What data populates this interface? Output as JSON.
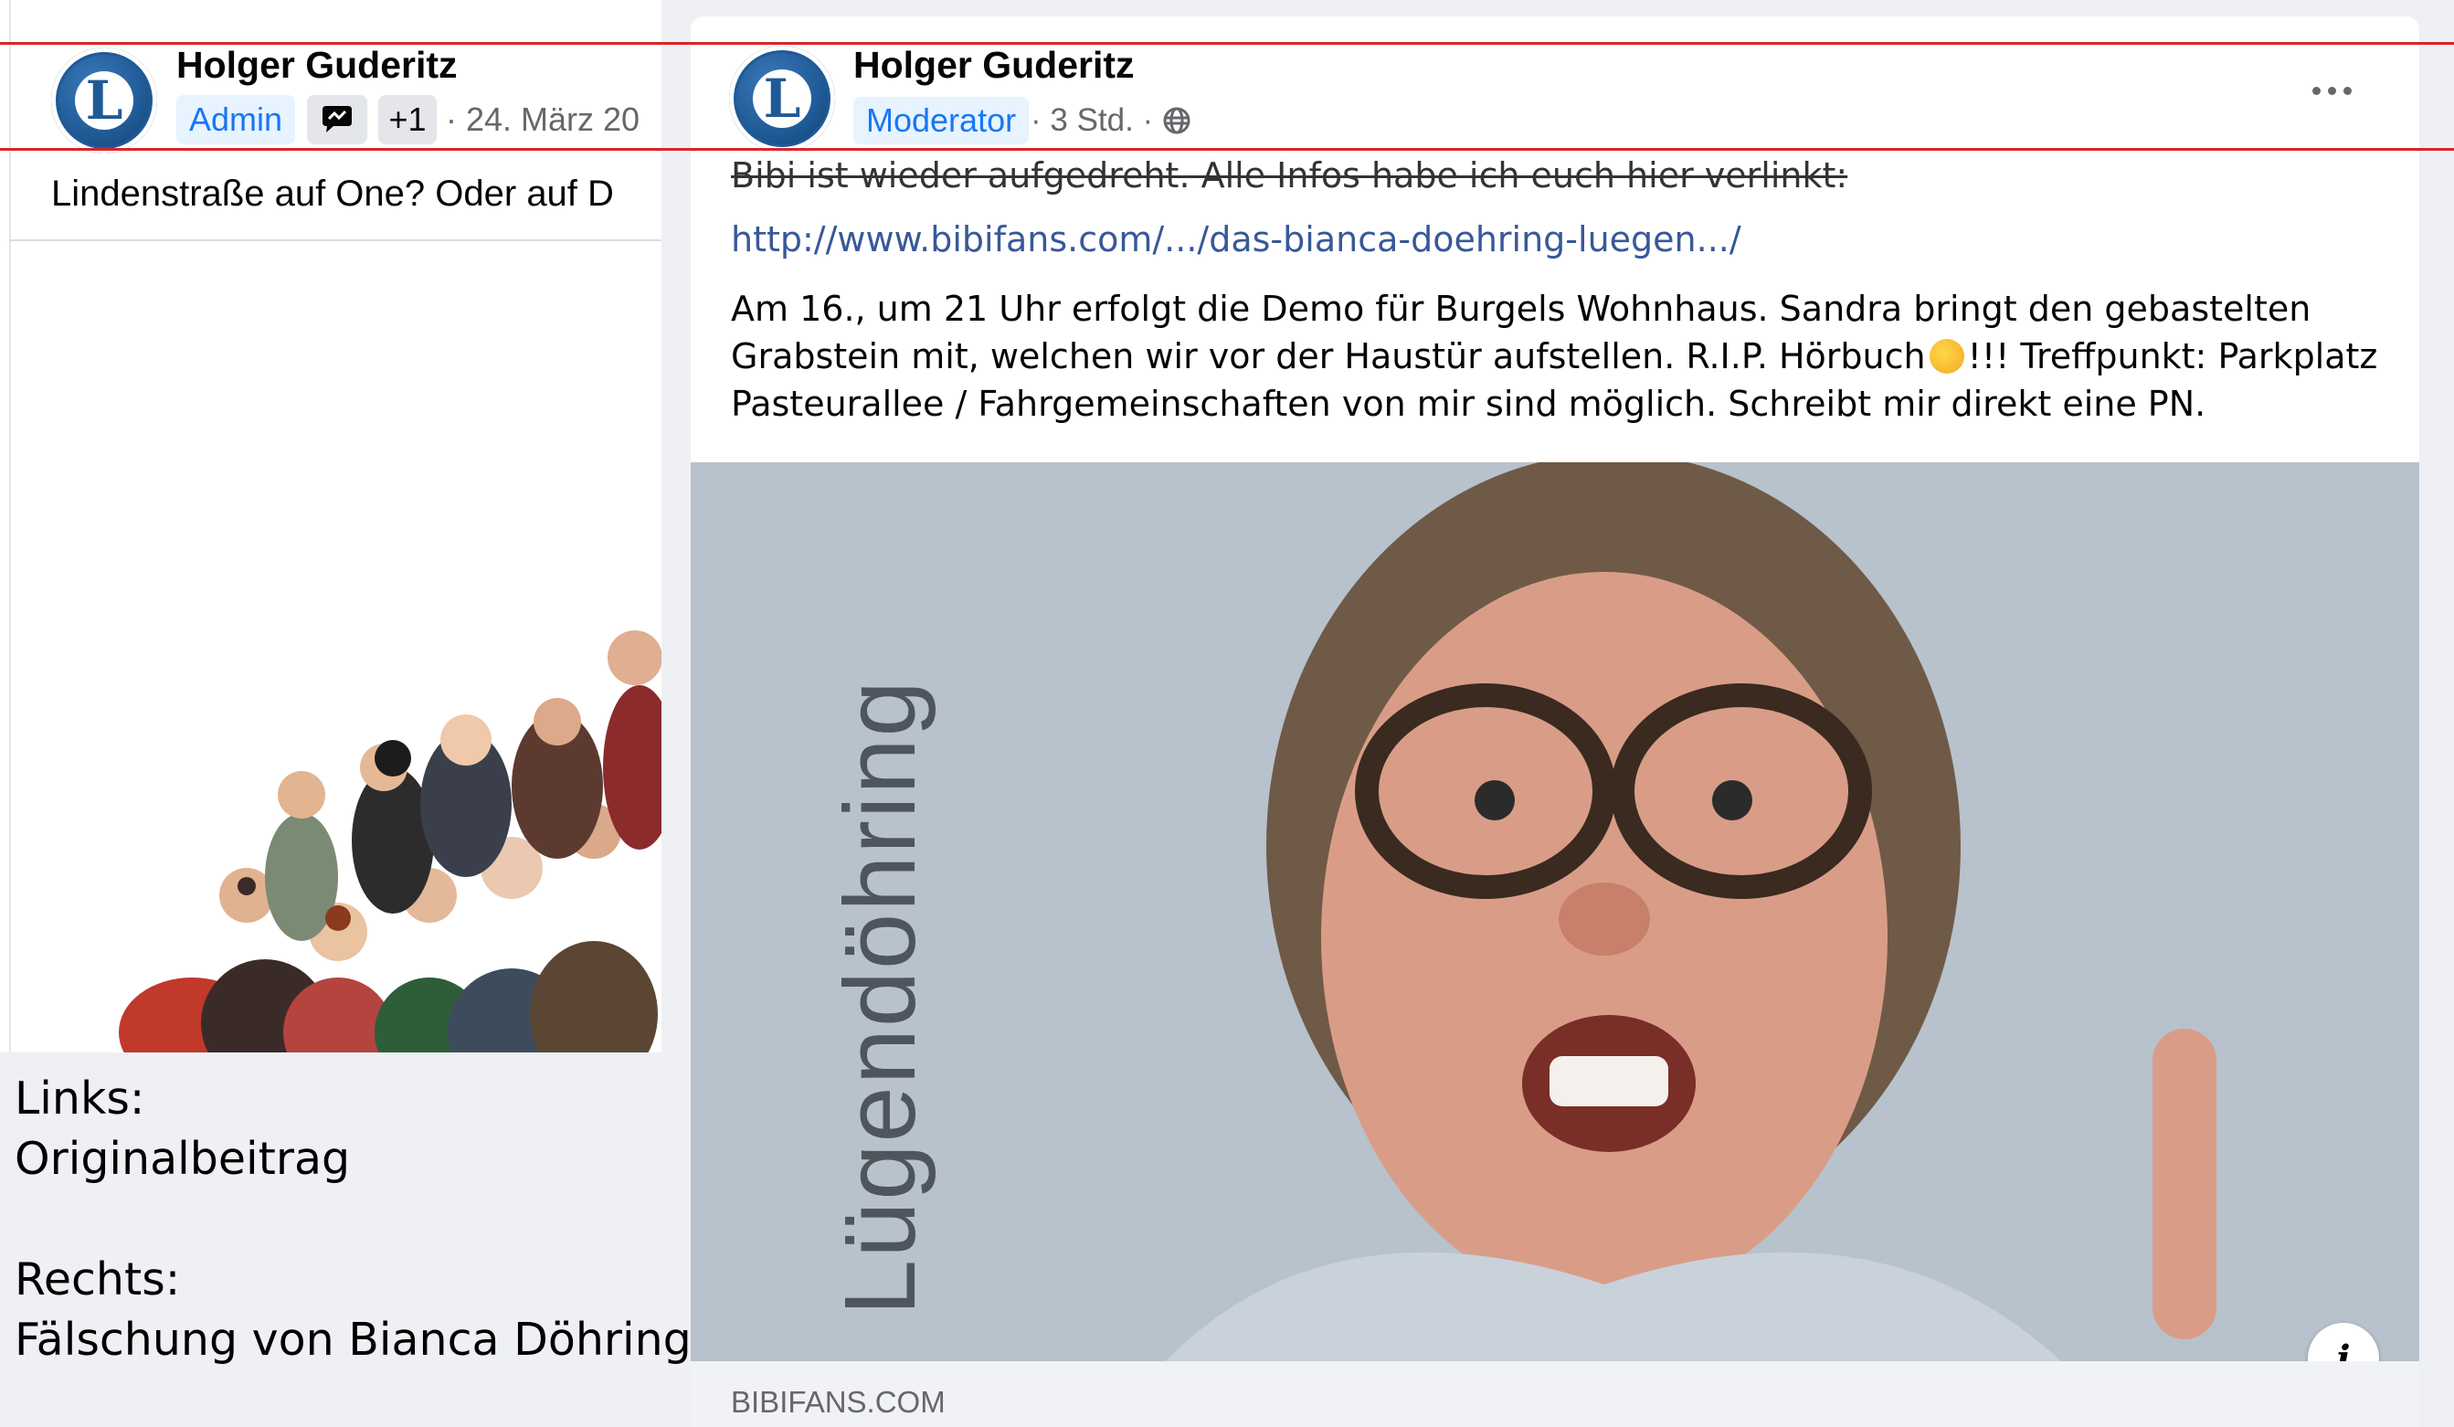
{
  "left_post": {
    "author": "Holger Guderitz",
    "role_badge": "Admin",
    "extra_badge": "+1",
    "date": "· 24. März 20",
    "text": "Lindenstraße auf One? Oder auf D",
    "logo_letter": "L"
  },
  "caption": {
    "line1": "Links:",
    "line2": "Originalbeitrag",
    "line3": "Rechts:",
    "line4": "Fälschung von Bianca Döhring"
  },
  "right_post": {
    "author": "Holger Guderitz",
    "role_badge": "Moderator",
    "time": "· 3 Std. ·",
    "logo_letter": "L",
    "strike_text": "Bibi ist wieder aufgedreht. Alle Infos habe ich euch hier verlinkt:",
    "link_text": "http://www.bibifans.com/.../das-bianca-doehring-luegen.../",
    "body_line1": "Am 16., um 21 Uhr erfolgt die Demo für Burgels Wohnhaus. Sandra bringt den gebastelten",
    "body_line2_a": "Grabstein mit, welchen wir vor der Haustür aufstellen. R.I.P. Hörbuch",
    "body_line2_b": "!!! Treffpunkt: Parkplatz",
    "body_line3": "Pasteurallee / Fahrgemeinschaften von mir sind möglich. Schreibt mir direkt eine PN.",
    "image_text": "Lügendöhring",
    "info_label": "i",
    "domain": "BIBIFANS.COM"
  },
  "colors": {
    "accent_blue": "#1877f2",
    "link": "#385898",
    "annotation_red": "#d9262b",
    "logo_blue": "#1f5a96"
  },
  "icons": [
    "chat-bubble-icon",
    "globe-icon",
    "more-icon",
    "info-icon",
    "laughing-emoji-icon"
  ]
}
